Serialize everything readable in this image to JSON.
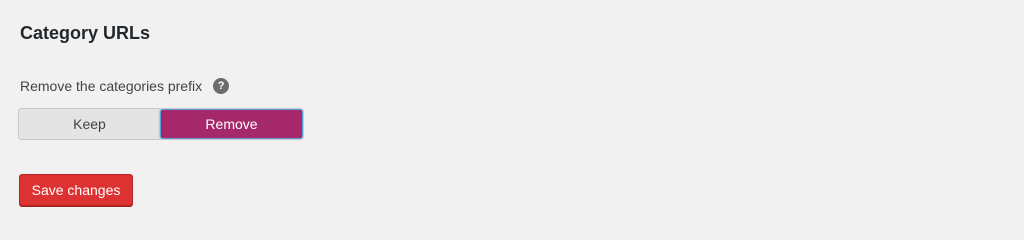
{
  "section": {
    "title": "Category URLs"
  },
  "field": {
    "label": "Remove the categories prefix",
    "help_icon": "question-mark-icon",
    "help_glyph": "?"
  },
  "toggle": {
    "options": [
      {
        "label": "Keep",
        "selected": false
      },
      {
        "label": "Remove",
        "selected": true
      }
    ],
    "selected_value": "Remove"
  },
  "actions": {
    "save_label": "Save changes"
  },
  "colors": {
    "background": "#f1f1f1",
    "selected_toggle": "#a4286a",
    "unselected_toggle": "#e4e4e4",
    "save_button": "#dc3232",
    "focus_ring": "#5b9dd9"
  }
}
